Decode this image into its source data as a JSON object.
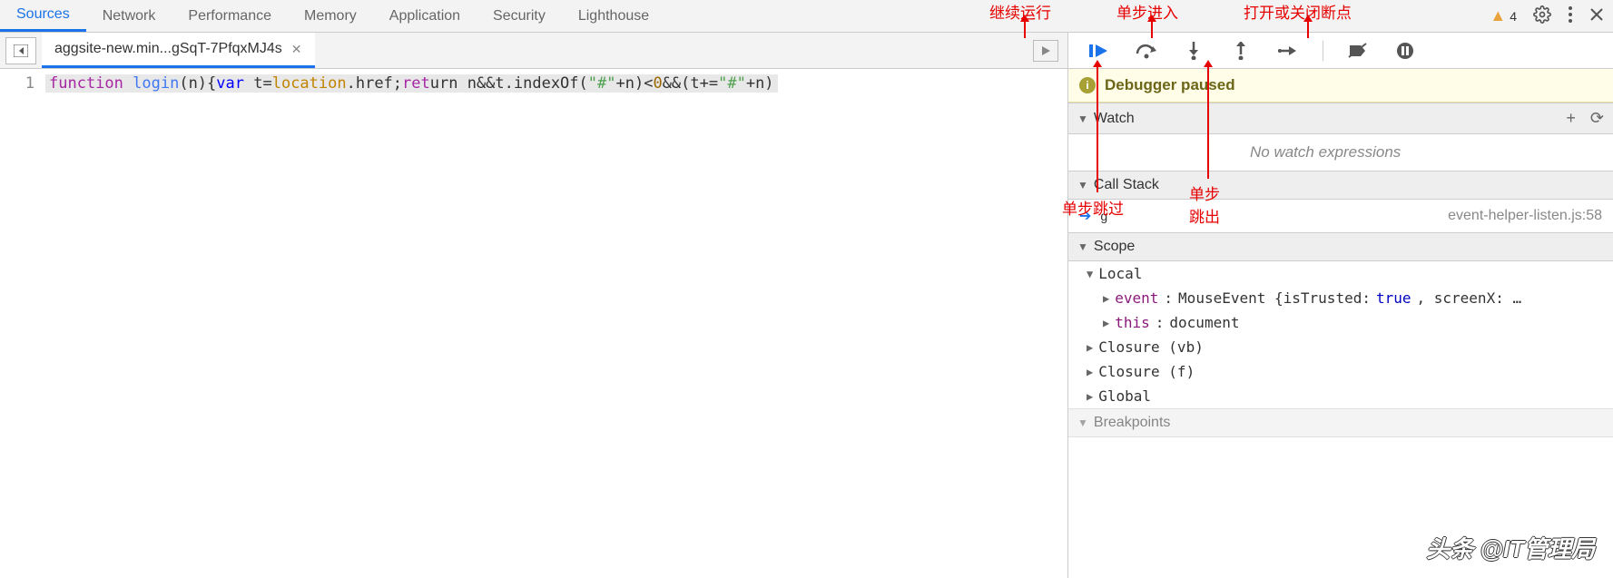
{
  "tabs": {
    "sources": "Sources",
    "network": "Network",
    "performance": "Performance",
    "memory": "Memory",
    "application": "Application",
    "security": "Security",
    "lighthouse": "Lighthouse"
  },
  "warnings_count": "4",
  "file_tab": "aggsite-new.min...gSqT-7PfqxMJ4s",
  "line_number": "1",
  "code": {
    "function": "function",
    "login": "login",
    "lparen_n": "(n){",
    "var": "var",
    "t_eq": " t=",
    "location": "location",
    "dot_href": ".href;",
    "return": "ret",
    "urn": "urn ",
    "rest1": "n&&t.indexOf(",
    "str1": "\"#\"",
    "rest2": "+n)<",
    "zero": "0",
    "rest3": "&&(t+=",
    "str2": "\"#\"",
    "rest4": "+n)"
  },
  "debugger_paused": "Debugger paused",
  "sections": {
    "watch": "Watch",
    "no_watch": "No watch expressions",
    "call_stack": "Call Stack",
    "stack_fn": "g",
    "stack_src": "event-helper-listen.js:58",
    "scope": "Scope",
    "local": "Local",
    "event": "event",
    "event_val": "MouseEvent {isTrusted: ",
    "true": "true",
    "event_rest": ", screenX: …",
    "this": "this",
    "this_val": "document",
    "closure_vb": "Closure (vb)",
    "closure_f": "Closure (f)",
    "global": "Global",
    "breakpoints": "Breakpoints"
  },
  "annotations": {
    "resume": "继续运行",
    "step_into": "单步进入",
    "toggle_bp": "打开或关闭断点",
    "step_over": "单步跳过",
    "step_out": "单步\n跳出"
  },
  "watermark": "头条 @IT管理局"
}
